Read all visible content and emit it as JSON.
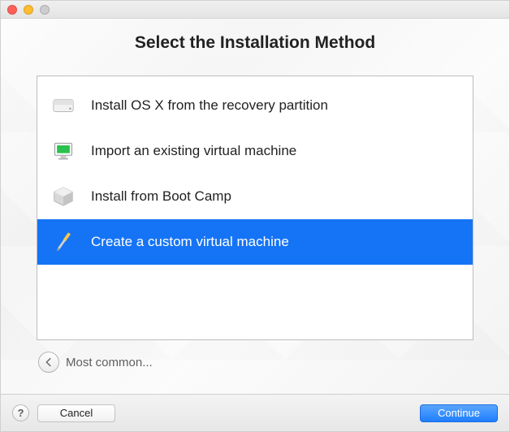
{
  "title": "Select the Installation Method",
  "options": [
    {
      "label": "Install OS X from the recovery partition",
      "icon": "hard-drive-icon",
      "selected": false
    },
    {
      "label": "Import an existing virtual machine",
      "icon": "monitor-icon",
      "selected": false
    },
    {
      "label": "Install from Boot Camp",
      "icon": "bootcamp-icon",
      "selected": false
    },
    {
      "label": "Create a custom virtual machine",
      "icon": "screwdriver-icon",
      "selected": true
    }
  ],
  "back_label": "Most common...",
  "footer": {
    "cancel": "Cancel",
    "continue": "Continue"
  }
}
